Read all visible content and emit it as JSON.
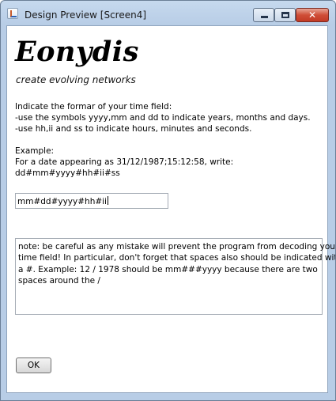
{
  "window": {
    "title": "Design Preview [Screen4]",
    "close_glyph": "✕"
  },
  "header": {
    "logo": "Eonydis",
    "tagline": "create evolving networks"
  },
  "instructions": {
    "lines": [
      "Indicate the formar of your time field:",
      "-use the symbols yyyy,mm and dd to indicate years, months and days.",
      "-use hh,ii and ss to indicate hours, minutes and seconds."
    ]
  },
  "example": {
    "lines": [
      "Example:",
      "For a date appearing as 31/12/1987;15:12:58, write:",
      "dd#mm#yyyy#hh#ii#ss"
    ]
  },
  "format_input": {
    "value": "mm#dd#yyyy#hh#ii"
  },
  "note": {
    "lines": [
      "note: be careful as any mistake will prevent the program from decoding your",
      "time field! In particular, don't forget that spaces also should be indicated with",
      "a #. Example: 12 / 1978 should be mm###yyyy because there are two",
      "spaces around the /"
    ]
  },
  "buttons": {
    "ok": "OK"
  }
}
